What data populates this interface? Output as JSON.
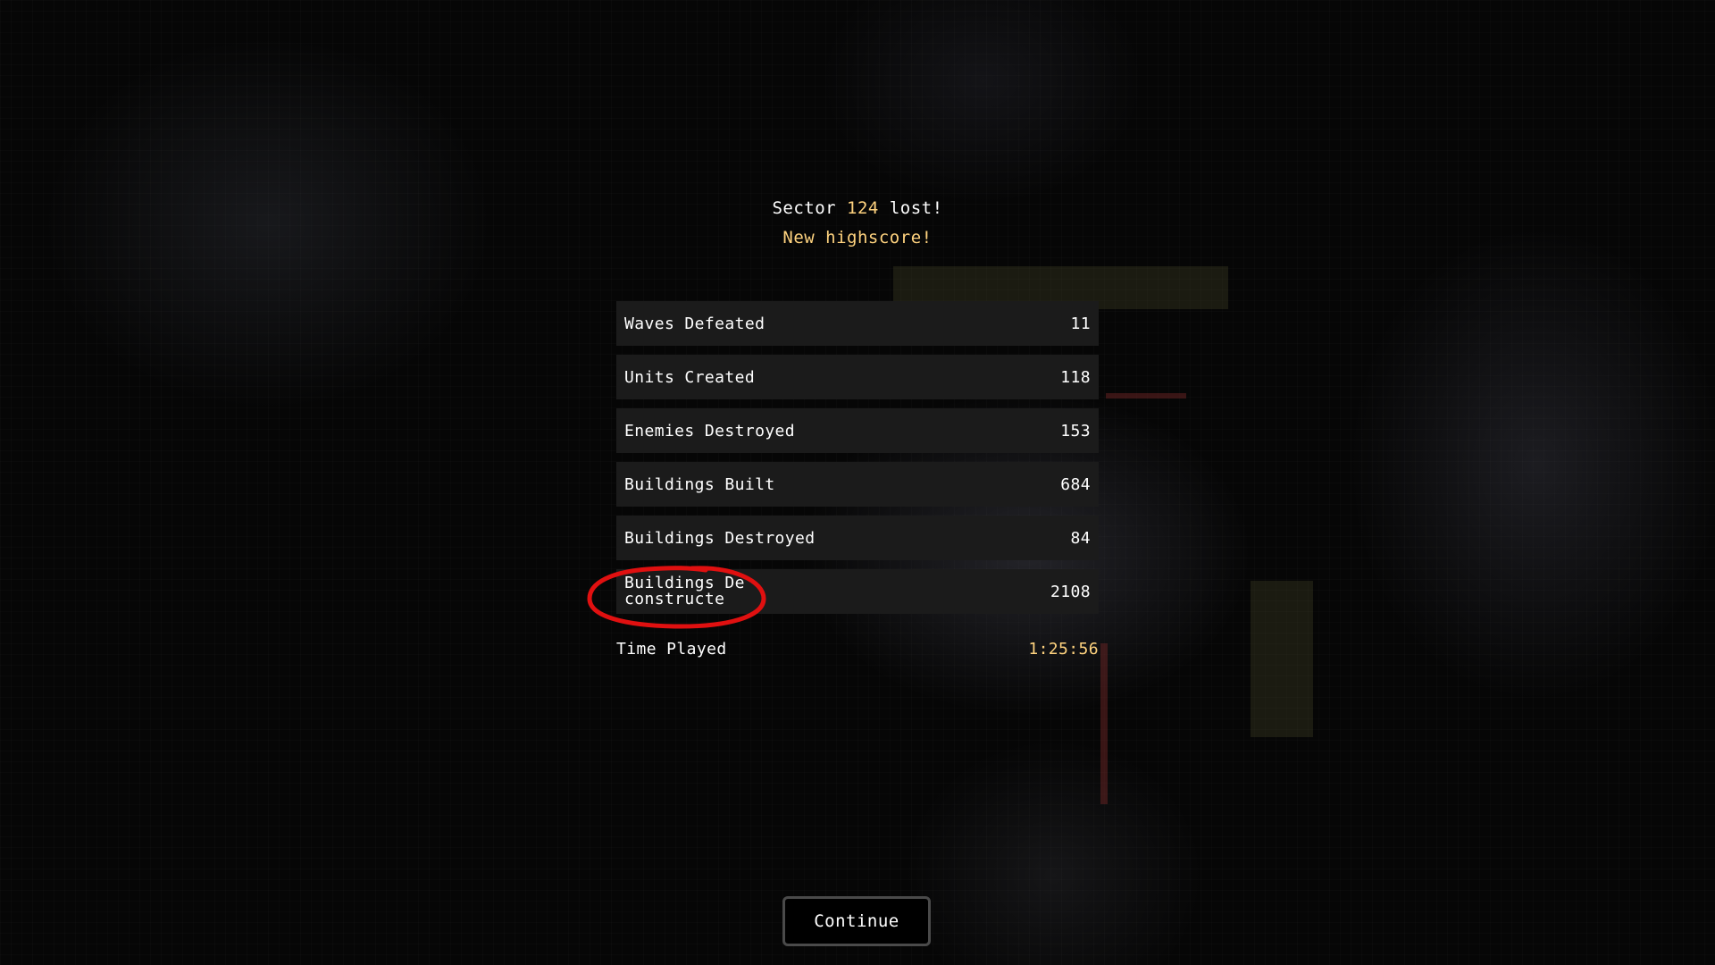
{
  "header": {
    "prefix": "Sector ",
    "sector_number": "124",
    "suffix": " lost!",
    "subtitle": "New highscore!"
  },
  "stats": [
    {
      "label": "Waves Defeated",
      "value": "11"
    },
    {
      "label": "Units Created",
      "value": "118"
    },
    {
      "label": "Enemies Destroyed",
      "value": "153"
    },
    {
      "label": "Buildings Built",
      "value": "684"
    },
    {
      "label": "Buildings Destroyed",
      "value": "84"
    },
    {
      "label": "Buildings Deconstructe",
      "value": "2108"
    }
  ],
  "time_played": {
    "label": "Time Played",
    "value": "1:25:56"
  },
  "continue_button": {
    "label": "Continue"
  },
  "colors": {
    "accent": "#ffd37f",
    "row_background": "#1b1b1b",
    "annotation": "#e01010"
  }
}
